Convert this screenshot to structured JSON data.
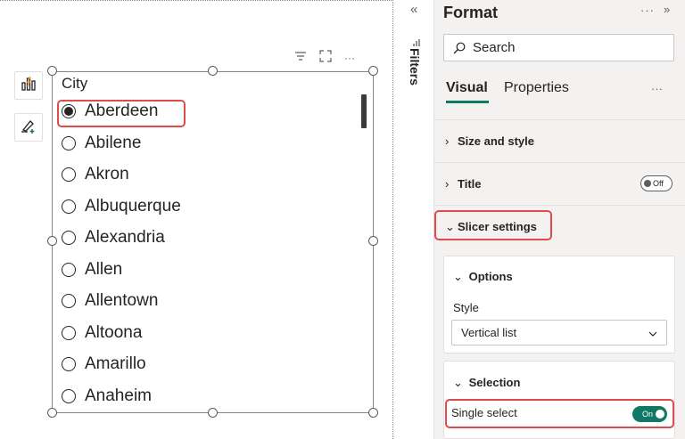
{
  "slicer": {
    "title": "City",
    "items": [
      {
        "label": "Aberdeen",
        "selected": true
      },
      {
        "label": "Abilene",
        "selected": false
      },
      {
        "label": "Akron",
        "selected": false
      },
      {
        "label": "Albuquerque",
        "selected": false
      },
      {
        "label": "Alexandria",
        "selected": false
      },
      {
        "label": "Allen",
        "selected": false
      },
      {
        "label": "Allentown",
        "selected": false
      },
      {
        "label": "Altoona",
        "selected": false
      },
      {
        "label": "Amarillo",
        "selected": false
      },
      {
        "label": "Anaheim",
        "selected": false
      }
    ],
    "header_icons": [
      "filter-icon",
      "focus-mode-icon",
      "more-options-icon"
    ],
    "more_label": "···"
  },
  "side_buttons": [
    "build-visual-icon",
    "format-visual-icon"
  ],
  "filters": {
    "label": "Filters",
    "collapse_glyph": "«",
    "icon": "filter-bars-icon"
  },
  "format_pane": {
    "title": "Format",
    "more_label": "···",
    "collapse_glyph": "»",
    "search_placeholder": "Search",
    "tabs": {
      "visual": "Visual",
      "properties": "Properties",
      "more": "···"
    },
    "sections": {
      "size_and_style": "Size and style",
      "title": "Title",
      "title_toggle": "Off",
      "slicer_settings": "Slicer settings"
    },
    "options_card": {
      "header": "Options",
      "style_label": "Style",
      "style_value": "Vertical list"
    },
    "selection_card": {
      "header": "Selection",
      "single_select_label": "Single select",
      "single_select_toggle": "On"
    }
  },
  "colors": {
    "accent": "#117865",
    "highlight_box": "#e04b4b",
    "pane_background": "#f3f2f1"
  }
}
